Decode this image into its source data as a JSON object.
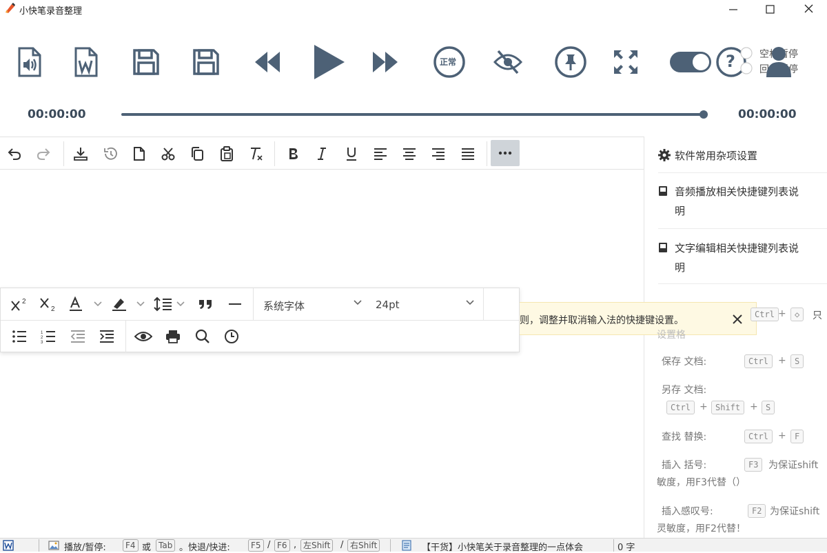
{
  "window": {
    "title": "小快笔录音整理",
    "controls": [
      "minimize",
      "maximize",
      "close"
    ]
  },
  "media_toolbar": {
    "buttons": [
      {
        "name": "open-audio",
        "icon": "audio-file-icon"
      },
      {
        "name": "open-word",
        "icon": "word-file-icon"
      },
      {
        "name": "save",
        "icon": "save-icon"
      },
      {
        "name": "save-as",
        "icon": "save-as-icon"
      },
      {
        "name": "rewind",
        "icon": "rewind-icon"
      },
      {
        "name": "play",
        "icon": "play-icon"
      },
      {
        "name": "fast-forward",
        "icon": "fast-forward-icon"
      },
      {
        "name": "speed-normal",
        "icon": "speed-normal-icon",
        "label": "正常"
      },
      {
        "name": "hide",
        "icon": "eye-slash-icon"
      },
      {
        "name": "pin",
        "icon": "pin-icon"
      },
      {
        "name": "fullscreen",
        "icon": "expand-icon"
      },
      {
        "name": "toggle",
        "icon": "toggle-icon",
        "on": true
      },
      {
        "name": "help",
        "icon": "help-icon",
        "label": "?"
      },
      {
        "name": "user",
        "icon": "user-icon"
      }
    ],
    "pause_options": {
      "option1": "空格暂停",
      "option2": "回车暂停"
    }
  },
  "playback": {
    "current_time": "00:00:00",
    "total_time": "00:00:00",
    "progress": 1.0
  },
  "editor_toolbar": {
    "buttons": [
      "undo",
      "redo",
      "download",
      "history",
      "new-document",
      "cut",
      "copy",
      "paste",
      "clear-format",
      "bold",
      "italic",
      "underline",
      "align-left",
      "align-center",
      "align-right",
      "justify",
      "more"
    ]
  },
  "float_toolbar": {
    "font_family": "系统字体",
    "font_size": "24pt",
    "row1_buttons": [
      "superscript",
      "subscript",
      "font-color",
      "highlight",
      "line-height",
      "blockquote",
      "horizontal-rule"
    ],
    "row2_buttons": [
      "bullet-list",
      "numbered-list",
      "outdent",
      "indent",
      "preview",
      "print",
      "find",
      "history"
    ]
  },
  "notice": {
    "text": "则，调整并取消输入法的快捷键设置。",
    "close": "×"
  },
  "right_panel": {
    "sections": [
      {
        "icon": "gear-icon",
        "title": "软件常用杂项设置"
      },
      {
        "icon": "book-icon",
        "title_line1": "音频播放相关快捷键列表说",
        "title_line2": "明"
      },
      {
        "icon": "book-icon",
        "title_line1": "文字编辑相关快捷键列表说",
        "title_line2": "明"
      }
    ],
    "partial_row": {
      "key1": "Ctrl",
      "plus": "+",
      "key2": "◇",
      "text": "只"
    },
    "partial_label": "设置格",
    "shortcuts": {
      "save": {
        "label": "保存  文档:",
        "keys": [
          "Ctrl",
          "S"
        ]
      },
      "save_as": {
        "label": "另存  文档:",
        "keys": [
          "Ctrl",
          "Shift",
          "S"
        ]
      },
      "find": {
        "label": "查找  替换:",
        "keys": [
          "Ctrl",
          "F"
        ]
      },
      "insert_bracket": {
        "label": "插入  括号:",
        "key": "F3",
        "note": "为保证shift",
        "note2": "敏度，用F3代替（）"
      },
      "insert_excl": {
        "label": "插入感叹号:",
        "key": "F2",
        "note": "为保证shift",
        "note2": "灵敏度，用F2代替！"
      }
    }
  },
  "status_bar": {
    "play_pause_label": "播放/暂停:",
    "key_f4": "F4",
    "or": "或",
    "key_tab": "Tab",
    "seek_label": "。快退/快进:",
    "key_f5": "F5",
    "slash": "/",
    "key_f6": "F6",
    "comma": ",",
    "key_lshift": "左Shift",
    "key_rshift": "右Shift",
    "article": "【干货】小快笔关于录音整理的一点体会",
    "word_count": "0 字"
  },
  "colors": {
    "accent": "#4d6176",
    "notice_bg": "#fef9e3",
    "more_bg": "#cfd4d9"
  }
}
